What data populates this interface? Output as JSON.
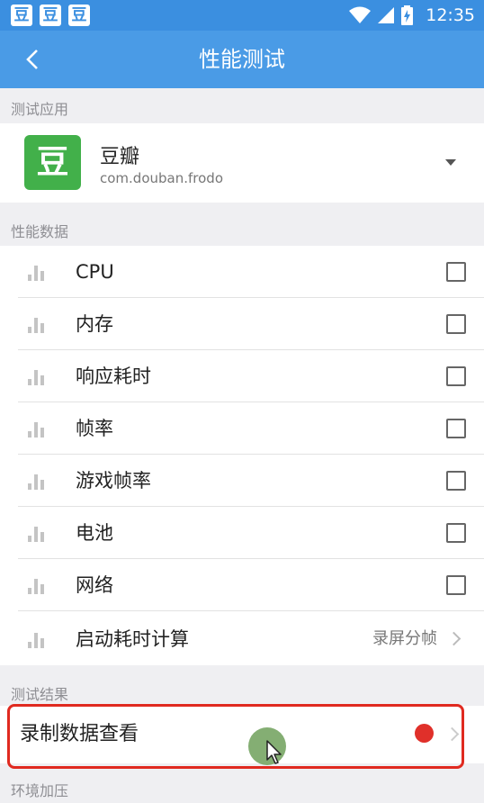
{
  "status_bar": {
    "notifications": [
      "豆",
      "豆",
      "豆"
    ],
    "time": "12:35",
    "icons": [
      "wifi-icon",
      "signal-icon",
      "battery-charging-icon"
    ]
  },
  "app_bar": {
    "back_icon": "chevron-left-icon",
    "title": "性能测试"
  },
  "test_app": {
    "section_label": "测试应用",
    "icon_glyph": "豆",
    "name": "豆瓣",
    "package": "com.douban.frodo",
    "dropdown_icon": "triangle-down-icon"
  },
  "performance_data": {
    "section_label": "性能数据",
    "items": [
      {
        "label": "CPU",
        "checked": false
      },
      {
        "label": "内存",
        "checked": false
      },
      {
        "label": "响应耗时",
        "checked": false
      },
      {
        "label": "帧率",
        "checked": false
      },
      {
        "label": "游戏帧率",
        "checked": false
      },
      {
        "label": "电池",
        "checked": false
      },
      {
        "label": "网络",
        "checked": false
      }
    ],
    "startup": {
      "label": "启动耗时计算",
      "value": "录屏分帧"
    }
  },
  "test_results": {
    "section_label": "测试结果",
    "record_label": "录制数据查看"
  },
  "env_pressure": {
    "section_label": "环境加压"
  },
  "colors": {
    "status_bar": "#3b8fe0",
    "app_bar": "#4a9be6",
    "app_icon": "#42b04a",
    "record_dot": "#e0302a",
    "highlight": "#e02a20"
  }
}
